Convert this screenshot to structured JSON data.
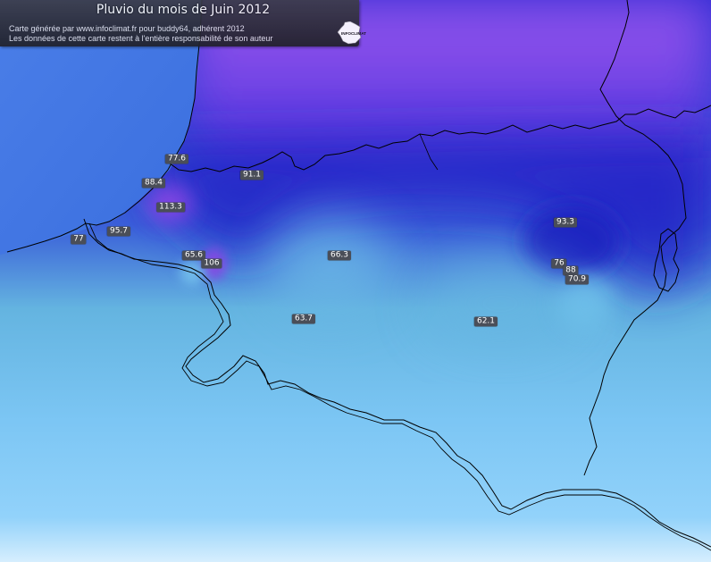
{
  "header": {
    "title": "Pluvio du mois de Juin 2012",
    "credit_line1": "Carte générée par www.infoclimat.fr pour buddy64, adhérent 2012",
    "credit_line2": "Les données de cette carte restent à l'entière responsabilité de son auteur",
    "logo_text": "INFOCLIMAT"
  },
  "colors": {
    "ocean": "#3b74e0",
    "high_rain": "#1f2cc8",
    "very_high_rain": "#8f4ee8",
    "medium_rain": "#5fb2e2",
    "low_rain": "#7dc6f4",
    "lowest_rain": "#c4e6fc",
    "label_bg": "#4a4e58",
    "border_line": "#000000"
  },
  "stations": [
    {
      "value": "77.6"
    },
    {
      "value": "91.1"
    },
    {
      "value": "88.4"
    },
    {
      "value": "113.3"
    },
    {
      "value": "95.7"
    },
    {
      "value": "77"
    },
    {
      "value": "65.6"
    },
    {
      "value": "106"
    },
    {
      "value": "66.3"
    },
    {
      "value": "63.7"
    },
    {
      "value": "62.1"
    },
    {
      "value": "93.3"
    },
    {
      "value": "76"
    },
    {
      "value": "88"
    },
    {
      "value": "70.9"
    }
  ]
}
